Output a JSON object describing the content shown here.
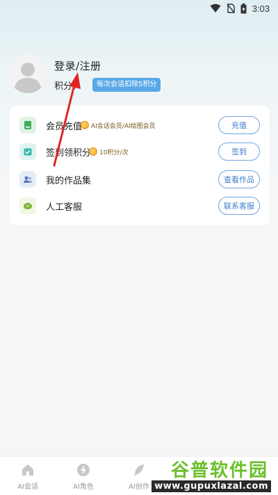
{
  "status_bar": {
    "time": "3:03"
  },
  "profile": {
    "login_label": "登录/注册",
    "points_label": "积分：",
    "points_badge": "每次会话扣除5积分"
  },
  "menu": [
    {
      "label": "会员充值",
      "tag": "AI会话会员/AI绘图会员",
      "button": "充值",
      "icon": "book-icon",
      "icon_bg": "#dff3e4",
      "icon_color": "#3fae5c"
    },
    {
      "label": "签到领积分",
      "tag": "10积分/次",
      "button": "签到",
      "icon": "calendar-check-icon",
      "icon_bg": "#dcf3f1",
      "icon_color": "#3ab8a8"
    },
    {
      "label": "我的作品集",
      "tag": "",
      "button": "查看作品",
      "icon": "users-icon",
      "icon_bg": "#e6ecf7",
      "icon_color": "#5a78b8"
    },
    {
      "label": "人工客服",
      "tag": "",
      "button": "联系客服",
      "icon": "headset-icon",
      "icon_bg": "#f1f7e3",
      "icon_color": "#7cb23a"
    }
  ],
  "bottom_nav": [
    {
      "label": "AI会话",
      "icon": "home-icon"
    },
    {
      "label": "AI角色",
      "icon": "lightning-icon"
    },
    {
      "label": "AI创作",
      "icon": "feather-icon"
    }
  ],
  "watermark": {
    "title": "谷普软件园",
    "url": "www.gupuxlazal.com"
  },
  "colors": {
    "accent": "#3f7fc8",
    "badge": "#5aa8e8",
    "annotation": "#e02424"
  }
}
